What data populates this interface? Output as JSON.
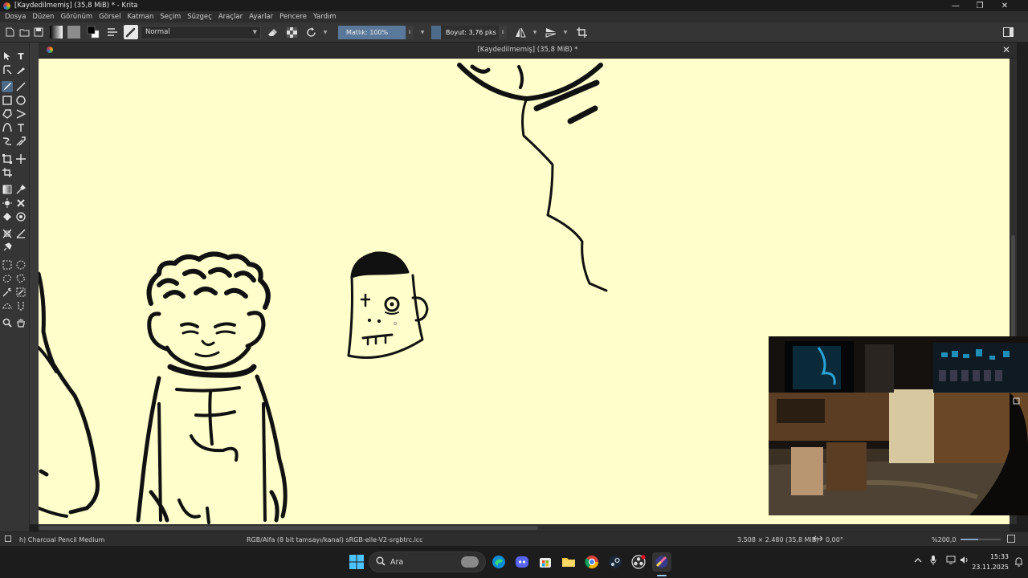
{
  "window": {
    "title": "[Kaydedilmemiş]  (35,8 MiB) * - Krita",
    "minimize_glyph": "—",
    "maximize_glyph": "❐",
    "close_glyph": "✕"
  },
  "menu": [
    "Dosya",
    "Düzen",
    "Görünüm",
    "Görsel",
    "Katman",
    "Seçim",
    "Süzgeç",
    "Araçlar",
    "Ayarlar",
    "Pencere",
    "Yardım"
  ],
  "toolbar": {
    "blend_mode": "Normal",
    "opacity": "Matlık: 100%",
    "size": "Boyut: 3,76 pks",
    "foreground_color": "#000000",
    "background_color": "#ffffff"
  },
  "document": {
    "tab_title": "[Kaydedilmemiş]  (35,8 MiB) *",
    "canvas_color": "#ffffcc",
    "close_glyph": "✕"
  },
  "status": {
    "brush_preset": "h) Charcoal Pencil Medium",
    "color_space": "RGB/Alfa (8 bit tamsayı/kanal)  sRGB-elle-V2-srgbtrc.icc",
    "image_size": "3.508 × 2.480 (35,8 MiB)",
    "rotation": "0,00°",
    "zoom": "%200,0"
  },
  "taskbar": {
    "search_placeholder": "Ara",
    "time": "15:33",
    "date": "23.11.2025"
  },
  "colors": {
    "accent": "#4d6a88",
    "canvas": "#ffffcc",
    "ink": "#111111"
  }
}
